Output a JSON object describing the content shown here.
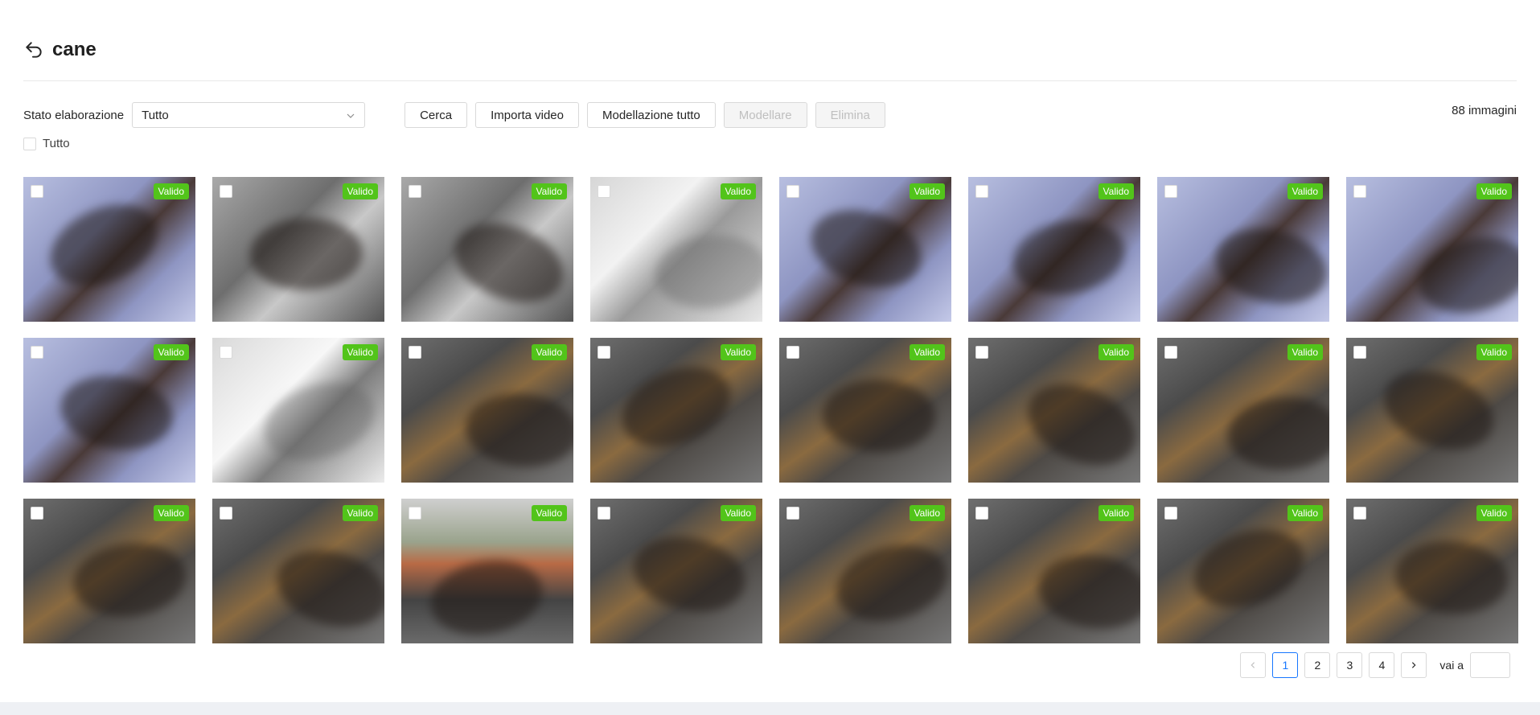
{
  "header": {
    "title": "cane",
    "back_icon": "undo-arrow-icon"
  },
  "toolbar": {
    "filter_label": "Stato elaborazione",
    "filter_value": "Tutto",
    "buttons": {
      "search": "Cerca",
      "import": "Importa video",
      "model_all": "Modellazione tutto",
      "model": "Modellare",
      "delete": "Elimina"
    },
    "count": "88 immagini"
  },
  "select_all_label": "Tutto",
  "gallery": {
    "badge_color": "#52c41a",
    "items": [
      {
        "status": "Valido",
        "style": "blue"
      },
      {
        "status": "Valido",
        "style": "gray"
      },
      {
        "status": "Valido",
        "style": "gray"
      },
      {
        "status": "Valido",
        "style": "white"
      },
      {
        "status": "Valido",
        "style": "blue"
      },
      {
        "status": "Valido",
        "style": "blue"
      },
      {
        "status": "Valido",
        "style": "blue"
      },
      {
        "status": "Valido",
        "style": "blue"
      },
      {
        "status": "Valido",
        "style": "blue"
      },
      {
        "status": "Valido",
        "style": "patio"
      },
      {
        "status": "Valido",
        "style": "dog"
      },
      {
        "status": "Valido",
        "style": "dog"
      },
      {
        "status": "Valido",
        "style": "dog"
      },
      {
        "status": "Valido",
        "style": "dog"
      },
      {
        "status": "Valido",
        "style": "dog"
      },
      {
        "status": "Valido",
        "style": "dog"
      },
      {
        "status": "Valido",
        "style": "dog"
      },
      {
        "status": "Valido",
        "style": "dog"
      },
      {
        "status": "Valido",
        "style": "plant"
      },
      {
        "status": "Valido",
        "style": "dog"
      },
      {
        "status": "Valido",
        "style": "dog"
      },
      {
        "status": "Valido",
        "style": "dog"
      },
      {
        "status": "Valido",
        "style": "dog"
      },
      {
        "status": "Valido",
        "style": "dog"
      }
    ]
  },
  "pagination": {
    "pages": [
      "1",
      "2",
      "3",
      "4"
    ],
    "current": "1",
    "prev_icon": "chevron-left-icon",
    "next_icon": "chevron-right-icon",
    "goto_label": "vai a",
    "active_color": "#1677ff"
  }
}
